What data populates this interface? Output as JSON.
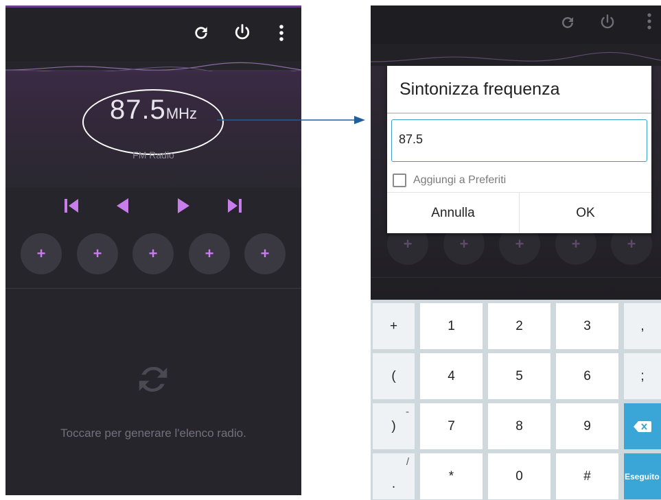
{
  "left_screen": {
    "frequency_value": "87.5",
    "frequency_unit": "MHz",
    "band_label": "FM Radio",
    "presets": [
      "+",
      "+",
      "+",
      "+",
      "+"
    ],
    "hint": "Toccare per generare l'elenco radio."
  },
  "right_screen": {
    "presets": [
      "+",
      "+",
      "+",
      "+",
      "+"
    ],
    "dialog": {
      "title": "Sintonizza frequenza",
      "input_value": "87.5",
      "checkbox_label": "Aggiungi a Preferiti",
      "cancel_label": "Annulla",
      "ok_label": "OK"
    },
    "keyboard": {
      "row1": [
        "+",
        "1",
        "2",
        "3",
        ","
      ],
      "row2": [
        "(",
        "4",
        "5",
        "6",
        ";"
      ],
      "row3": [
        ")",
        "7",
        "8",
        "9"
      ],
      "row3_sup": "-",
      "row4": [
        ".",
        "*",
        "0",
        "#"
      ],
      "row4_sup": "/",
      "done_label": "Eseguito"
    }
  },
  "colors": {
    "accent_purple": "#c77dea",
    "accent_blue": "#3aa6d8",
    "arrow_blue": "#1f5f9a"
  }
}
